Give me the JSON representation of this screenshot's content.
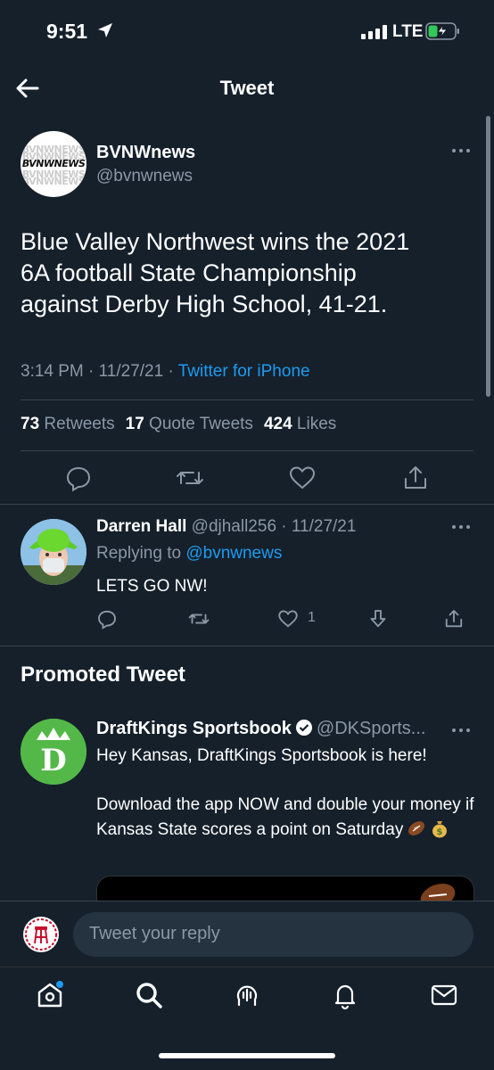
{
  "status": {
    "time": "9:51",
    "network": "LTE"
  },
  "header": {
    "title": "Tweet"
  },
  "tweet": {
    "author_name": "BVNWnews",
    "author_handle": "@bvnwnews",
    "avatar_text": "BVNWNEWS",
    "text": "Blue Valley Northwest wins the 2021\n6A football State Championship\nagainst Derby High School, 41-21.",
    "time": "3:14 PM · 11/27/21 · ",
    "source": "Twitter for iPhone",
    "retweets_count": "73",
    "retweets_label": "Retweets",
    "quotes_count": "17",
    "quotes_label": "Quote Tweets",
    "likes_count": "424",
    "likes_label": "Likes"
  },
  "reply": {
    "name": "Darren Hall",
    "handle_date": " @djhall256 · 11/27/21",
    "replying_to_label": "Replying to ",
    "replying_to_handle": "@bvnwnews",
    "text": "LETS GO NW!",
    "like_count": "1"
  },
  "promoted": {
    "section_title": "Promoted Tweet",
    "name": "DraftKings Sportsbook",
    "handle": "@DKSports...",
    "text": "Hey Kansas, DraftKings Sportsbook is here!\n\nDownload the app NOW and double your money if Kansas State scores a point on Saturday"
  },
  "compose": {
    "placeholder": "Tweet your reply"
  },
  "colors": {
    "background": "#15202b",
    "accent": "#1d9bf0",
    "muted": "#8b98a5",
    "divider": "#38444d"
  }
}
